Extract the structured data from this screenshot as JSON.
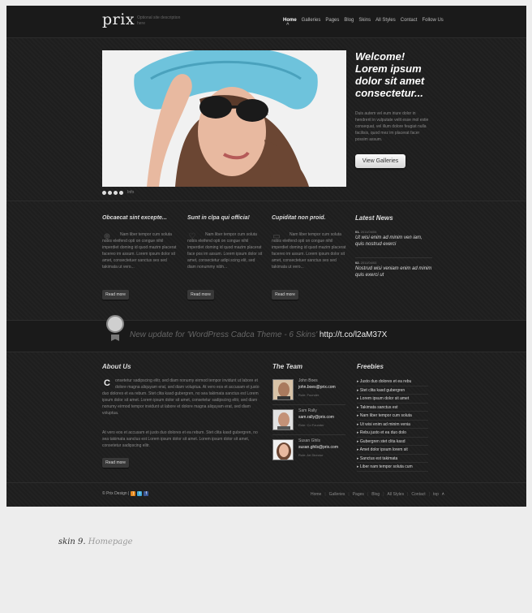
{
  "header": {
    "logo": "prix",
    "tagline": "Optional site description here",
    "nav": [
      "Home",
      "Galleries",
      "Pages",
      "Blog",
      "Skins",
      "All Styles",
      "Contact",
      "Follow Us"
    ]
  },
  "hero": {
    "title": "Welcome! Lorem ipsum dolor sit amet consectetur...",
    "text": "Duis autem vel eum iriure dolor in hendrerit in vulputate velit esse mol estie consequat, vel illum dolore feugiat nulla facilisis, quod mez im placerat facer possim assum.",
    "button": "View Galleries",
    "slider_label": "Info"
  },
  "columns": [
    {
      "title": "Obcaecat sint excepte...",
      "icon": "plus-icon",
      "text": "Nam liber tempor cum soluta nobis eleifend opti on congue nihil imperdiet doming id quod mazim placerat facereo im assum. Lorem ipsum dolor sit amet, consectetuer sanctus ses sed takimata ut vero...",
      "button": "Read more"
    },
    {
      "title": "Sunt in clpa qui officia!",
      "icon": "heart-icon",
      "text": "Nam liber tempor cum soluta nobis eleifend opti on congue nihil imperdiet doming id quod mazim placerat face pos im assum. Lorem ipsum dolor sit amet, consectetur adipi scing elit, sed diam nonummy nibh...",
      "button": "Read more"
    },
    {
      "title": "Cupiditat non proid.",
      "icon": "chat-icon",
      "text": "Nam liber tempor cum soluta nobis eleifend opti on congue nihil imperdiet doming id quod mazim placerat facereo im assum. Lorem ipsum dolor sit amet, consectetuer sanctus ses sed takimata ut vero...",
      "button": "Read more"
    }
  ],
  "news": {
    "title": "Latest News",
    "items": [
      {
        "num": "01.",
        "date": "2011/04/04",
        "title": "Ut wisi enim ad minim ven iam, quis nostrud exerci"
      },
      {
        "num": "02.",
        "date": "2011/04/03",
        "title": "Nostrud wisi veniam enim ad minim quis exerci ut"
      }
    ]
  },
  "tweet": {
    "text": "New update for 'WordPress Cadca Theme - 6 Skins'",
    "link": "http://t.co/l2aM37X"
  },
  "about": {
    "title": "About Us",
    "dropcap": "C",
    "para1": "onsetetur sadipscing elitr, sed diam nonumy eirmod tempor invidunt ut labore et dolore magna aliquyam erat, sed diam voluptua. At vero eos et accusam et justo duo dolores et ea rebum. Stet clita kasd gubergren, no sea takimata sanctus est Lorem ipsum dolor sit amet. Lorem ipsum dolor sit amet, consetetur sadipscing elitr, sed diam nonumy eirmod tempor invidunt ut labore et dolore magna aliquyam erat, sed diam voluptua.",
    "para2": "At vero eos et accusam et justo duo dolores et ea rebum. Stet clita kasd gubergren, no sea takimata sanctus est Lorem ipsum dolor sit amet. Lorem ipsum dolor sit amet, consetetur sadipscing elitr.",
    "button": "Read more"
  },
  "team": {
    "title": "The Team",
    "members": [
      {
        "name": "John Boes",
        "email": "john.boes@prix.com",
        "role": "Role: Founder"
      },
      {
        "name": "Sam Rally",
        "email": "sam.rally@prix.com",
        "role": "Role: Co Founder"
      },
      {
        "name": "Susan Ghils",
        "email": "susan.ghils@prix.com",
        "role": "Role: Art Director"
      }
    ]
  },
  "freebies": {
    "title": "Freebies",
    "items": [
      "Justo duo dolores et ea rebu",
      "Stet clita kasd gubergren",
      "Lorem ipsum dolor sit amet",
      "Takimata sanctus est",
      "Nam liber tempor cum soluta",
      "Ut wisi enim ad minim venia",
      "Rebu justo et ea duo dolo",
      "Gubergren stet clita kasd",
      "Amet dolor ipsum lorem sit",
      "Sanctus est takimata",
      "Liber nam tempor soluta cum"
    ]
  },
  "footer": {
    "copyright": "© Prix Design |",
    "nav": [
      "Home",
      "Galleries",
      "Pages",
      "Blog",
      "All Styles",
      "Contact",
      "top"
    ]
  },
  "caption": {
    "skin": "skin 9.",
    "page": "Homepage"
  },
  "colors": {
    "background": "#1f1f1f",
    "page": "#ededed",
    "accent": "#ffffff"
  }
}
